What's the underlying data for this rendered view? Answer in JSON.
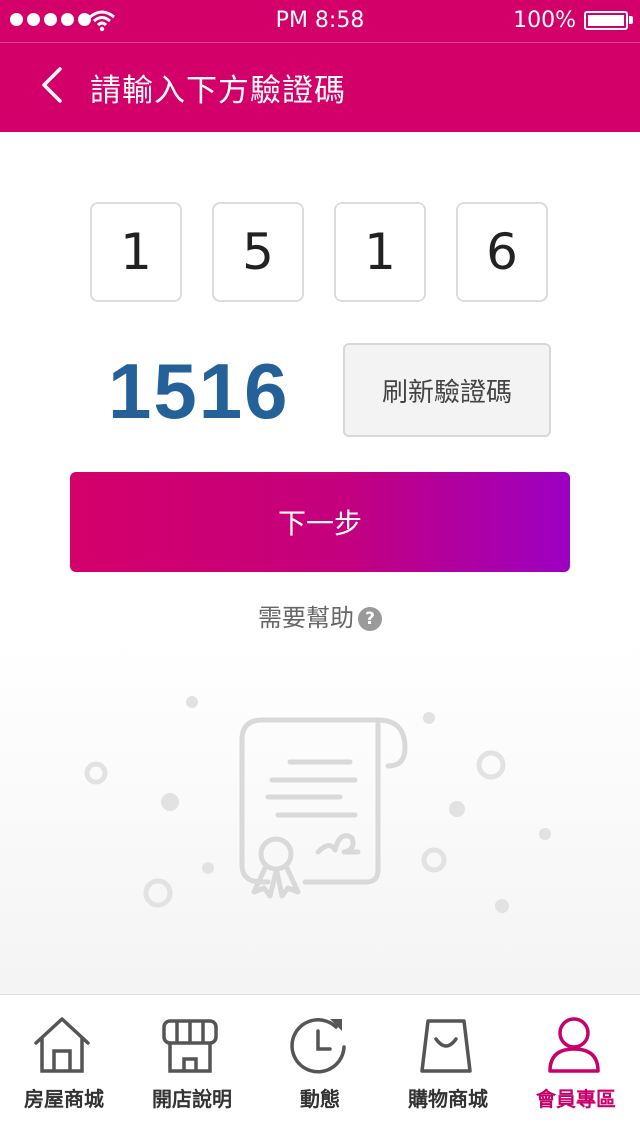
{
  "status_bar": {
    "time": "PM 8:58",
    "battery": "100%"
  },
  "header": {
    "title": "請輸入下方驗證碼"
  },
  "code_digits": [
    "1",
    "5",
    "1",
    "6"
  ],
  "captcha": {
    "value": "1516",
    "refresh_label": "刷新驗證碼"
  },
  "next_label": "下一步",
  "help": {
    "label": "需要幫助",
    "icon_glyph": "?"
  },
  "tabs": [
    {
      "label": "房屋商城",
      "icon": "house-icon"
    },
    {
      "label": "開店說明",
      "icon": "storefront-icon"
    },
    {
      "label": "動態",
      "icon": "clock-refresh-icon"
    },
    {
      "label": "購物商城",
      "icon": "shopping-bag-icon"
    },
    {
      "label": "會員專區",
      "icon": "user-icon",
      "active": true
    }
  ],
  "colors": {
    "brand": "#d4006a",
    "captcha": "#236198",
    "button_end": "#9c00c2",
    "active_tab": "#c8006a"
  }
}
